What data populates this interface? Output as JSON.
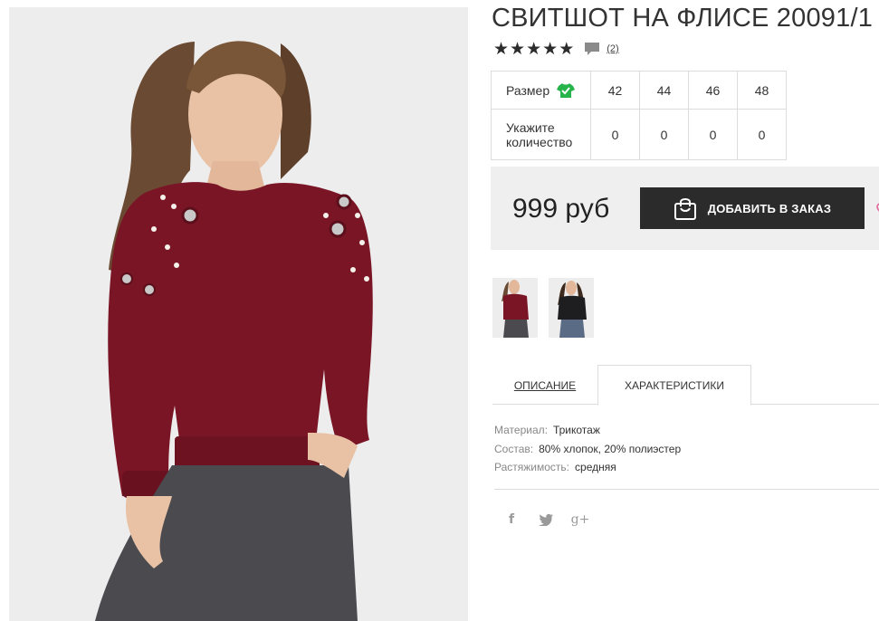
{
  "product": {
    "title": "СВИТШОТ НА ФЛИСЕ 20091/1",
    "stars": [
      "★",
      "★",
      "★",
      "★",
      "★"
    ],
    "reviews_link": "(2)",
    "photo_icon": "model-photo"
  },
  "sizes": {
    "size_label": "Размер",
    "size_icon": "shirt-check-icon",
    "qty_label": "Укажите количество",
    "values": [
      "42",
      "44",
      "46",
      "48"
    ],
    "quantities": [
      "0",
      "0",
      "0",
      "0"
    ]
  },
  "buy": {
    "price": "999 руб",
    "add_label": "ДОБАВИТЬ В ЗАКАЗ",
    "bag_icon": "shopping-bag-icon"
  },
  "tabs": {
    "description": "ОПИСАНИЕ",
    "characteristics": "ХАРАКТЕРИСТИКИ"
  },
  "specs": [
    {
      "key": "Материал:",
      "value": "Трикотаж"
    },
    {
      "key": "Состав:",
      "value": "80% хлопок, 20% полиэстер"
    },
    {
      "key": "Растяжимость:",
      "value": "средняя"
    }
  ],
  "social": {
    "facebook": "f",
    "twitter": "twitter-icon",
    "google": "g+"
  },
  "colors": {
    "accent_dark": "#2b2b2b",
    "burgundy": "#7a1526",
    "icon_green": "#25b34a",
    "wishlist_pink": "#e0689a"
  }
}
